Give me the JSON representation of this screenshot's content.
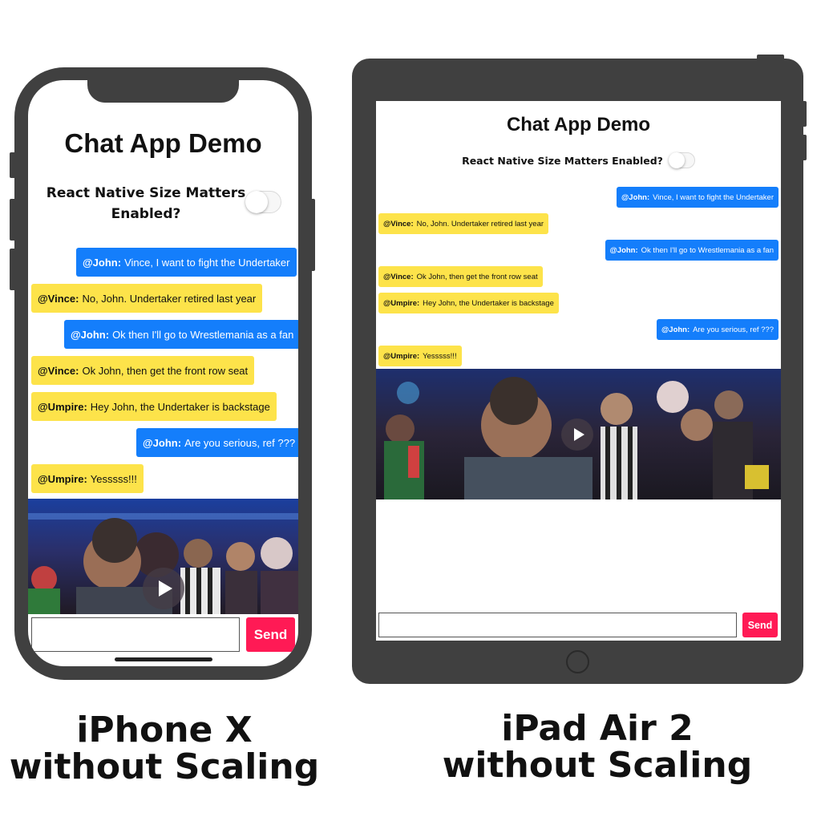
{
  "devices": [
    {
      "id": "iphone",
      "app_title": "Chat App Demo",
      "toggle_label_line1": "React Native Size Matters",
      "toggle_label_line2": "Enabled?",
      "messages": [
        {
          "from": "@John:",
          "text": "Vince, I want to fight the Undertaker",
          "side": "sent"
        },
        {
          "from": "@Vince:",
          "text": "No, John. Undertaker retired last year",
          "side": "recv"
        },
        {
          "from": "@John:",
          "text": "Ok then I'll go to Wrestlemania as a fan",
          "side": "sent"
        },
        {
          "from": "@Vince:",
          "text": "Ok John, then get the front row seat",
          "side": "recv"
        },
        {
          "from": "@Umpire:",
          "text": "Hey John, the Undertaker is backstage",
          "side": "recv"
        },
        {
          "from": "@John:",
          "text": "Are you serious, ref ???",
          "side": "sent"
        },
        {
          "from": "@Umpire:",
          "text": "Yesssss!!!",
          "side": "recv"
        }
      ],
      "send_label": "Send",
      "caption_line1": "iPhone X",
      "caption_line2": "without Scaling"
    },
    {
      "id": "ipad",
      "app_title": "Chat App Demo",
      "toggle_label": "React Native Size Matters Enabled?",
      "messages": [
        {
          "from": "@John:",
          "text": "Vince, I want to fight the Undertaker",
          "side": "sent"
        },
        {
          "from": "@Vince:",
          "text": "No, John. Undertaker retired last year",
          "side": "recv"
        },
        {
          "from": "@John:",
          "text": "Ok then I'll go to Wrestlemania as a fan",
          "side": "sent"
        },
        {
          "from": "@Vince:",
          "text": "Ok John, then get the front row seat",
          "side": "recv"
        },
        {
          "from": "@Umpire:",
          "text": "Hey John, the Undertaker is backstage",
          "side": "recv"
        },
        {
          "from": "@John:",
          "text": "Are you serious, ref ???",
          "side": "sent"
        },
        {
          "from": "@Umpire:",
          "text": "Yesssss!!!",
          "side": "recv"
        }
      ],
      "send_label": "Send",
      "caption_line1": "iPad Air 2",
      "caption_line2": "without Scaling"
    }
  ],
  "colors": {
    "device_frame": "#404040",
    "sent_bubble": "#147efb",
    "received_bubble": "#fde34a",
    "send_button": "#ff1a55"
  },
  "icons": {
    "video_play": "play-icon",
    "home_button": "home-button-icon"
  },
  "toggle_state": "off"
}
